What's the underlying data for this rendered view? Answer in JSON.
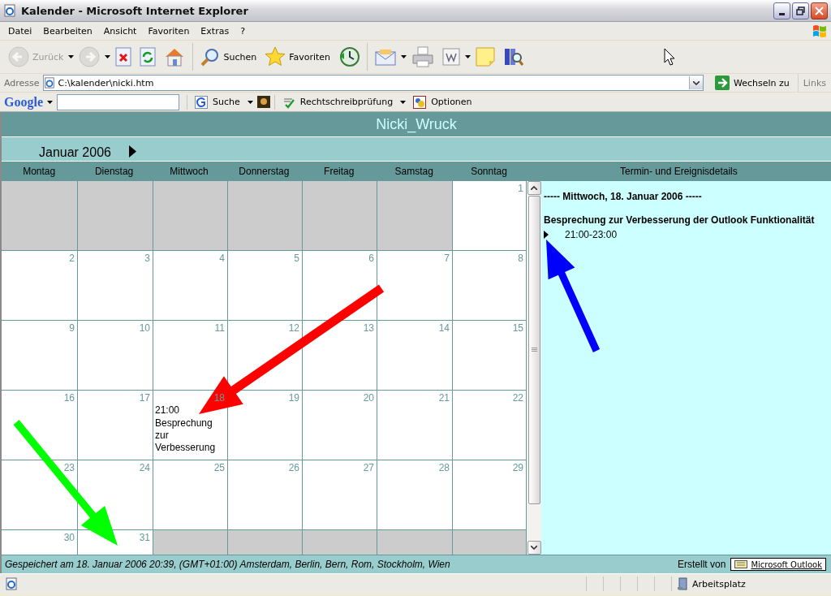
{
  "window": {
    "title": "Kalender - Microsoft Internet Explorer"
  },
  "menu": [
    "Datei",
    "Bearbeiten",
    "Ansicht",
    "Favoriten",
    "Extras",
    "?"
  ],
  "toolbar": [
    {
      "kind": "back",
      "label": "Zurück",
      "disabled": true,
      "dropdown": true
    },
    {
      "kind": "forward",
      "disabled": true,
      "dropdown": true
    },
    {
      "kind": "stop",
      "disabled": false,
      "dropdown": false
    },
    {
      "kind": "refresh",
      "disabled": false,
      "dropdown": false
    },
    {
      "kind": "home",
      "disabled": false,
      "dropdown": false
    },
    {
      "kind": "search",
      "label": "Suchen",
      "disabled": false,
      "dropdown": false
    },
    {
      "kind": "favorites",
      "label": "Favoriten",
      "disabled": false,
      "dropdown": false
    },
    {
      "kind": "history",
      "disabled": false,
      "dropdown": false
    },
    {
      "kind": "mail",
      "disabled": false,
      "dropdown": true
    },
    {
      "kind": "print",
      "disabled": false,
      "dropdown": false
    },
    {
      "kind": "word",
      "disabled": false,
      "dropdown": true
    },
    {
      "kind": "note",
      "disabled": false,
      "dropdown": false
    },
    {
      "kind": "research",
      "disabled": false,
      "dropdown": false
    }
  ],
  "address": {
    "label": "Adresse",
    "value": "C:\\kalender\\nicki.htm",
    "go": "Wechseln zu",
    "links": "Links"
  },
  "google_bar": {
    "logo": "Google",
    "search": "Suche",
    "spellcheck": "Rechtschreibprüfung",
    "options": "Optionen"
  },
  "calendar": {
    "owner": "Nicki_Wruck",
    "month": "Januar 2006",
    "weekdays": [
      "Montag",
      "Dienstag",
      "Mittwoch",
      "Donnerstag",
      "Freitag",
      "Samstag",
      "Sonntag"
    ],
    "weeks": [
      [
        {
          "kind": "empty"
        },
        {
          "kind": "empty"
        },
        {
          "kind": "empty"
        },
        {
          "kind": "empty"
        },
        {
          "kind": "empty"
        },
        {
          "kind": "empty"
        },
        {
          "kind": "day",
          "day": "1"
        }
      ],
      [
        {
          "kind": "day",
          "day": "2"
        },
        {
          "kind": "day",
          "day": "3"
        },
        {
          "kind": "day",
          "day": "4"
        },
        {
          "kind": "day",
          "day": "5"
        },
        {
          "kind": "day",
          "day": "6"
        },
        {
          "kind": "day",
          "day": "7"
        },
        {
          "kind": "day",
          "day": "8"
        }
      ],
      [
        {
          "kind": "day",
          "day": "9"
        },
        {
          "kind": "day",
          "day": "10"
        },
        {
          "kind": "day",
          "day": "11"
        },
        {
          "kind": "day",
          "day": "12"
        },
        {
          "kind": "day",
          "day": "13"
        },
        {
          "kind": "day",
          "day": "14"
        },
        {
          "kind": "day",
          "day": "15"
        }
      ],
      [
        {
          "kind": "day",
          "day": "16"
        },
        {
          "kind": "day",
          "day": "17"
        },
        {
          "kind": "day",
          "day": "18",
          "events": [
            {
              "time": "21:00",
              "title": "Besprechung zur Verbesserung"
            }
          ]
        },
        {
          "kind": "day",
          "day": "19"
        },
        {
          "kind": "day",
          "day": "20"
        },
        {
          "kind": "day",
          "day": "21"
        },
        {
          "kind": "day",
          "day": "22"
        }
      ],
      [
        {
          "kind": "day",
          "day": "23"
        },
        {
          "kind": "day",
          "day": "24"
        },
        {
          "kind": "day",
          "day": "25"
        },
        {
          "kind": "day",
          "day": "26"
        },
        {
          "kind": "day",
          "day": "27"
        },
        {
          "kind": "day",
          "day": "28"
        },
        {
          "kind": "day",
          "day": "29"
        }
      ],
      [
        {
          "kind": "day",
          "day": "30"
        },
        {
          "kind": "day",
          "day": "31"
        },
        {
          "kind": "empty"
        },
        {
          "kind": "empty"
        },
        {
          "kind": "empty"
        },
        {
          "kind": "empty"
        },
        {
          "kind": "empty"
        }
      ]
    ]
  },
  "details": {
    "heading": "Termin- und Ereignisdetails",
    "date": "----- Mittwoch, 18. Januar 2006 -----",
    "events": [
      {
        "title": "Besprechung zur Verbesserung der Outlook Funktionalität",
        "time": "21:00-23:00"
      }
    ]
  },
  "footer": {
    "saved": "Gespeichert am 18. Januar 2006 20:39, (GMT+01:00) Amsterdam, Berlin, Bern, Rom, Stockholm, Wien",
    "created_by": "Erstellt von",
    "badge": "Microsoft Outlook"
  },
  "status_bar": {
    "zone": "Arbeitsplatz"
  },
  "annotations": [
    {
      "kind": "arrow",
      "color": "#ff0000"
    },
    {
      "kind": "arrow",
      "color": "#0000ff"
    },
    {
      "kind": "arrow",
      "color": "#00ff00"
    }
  ]
}
